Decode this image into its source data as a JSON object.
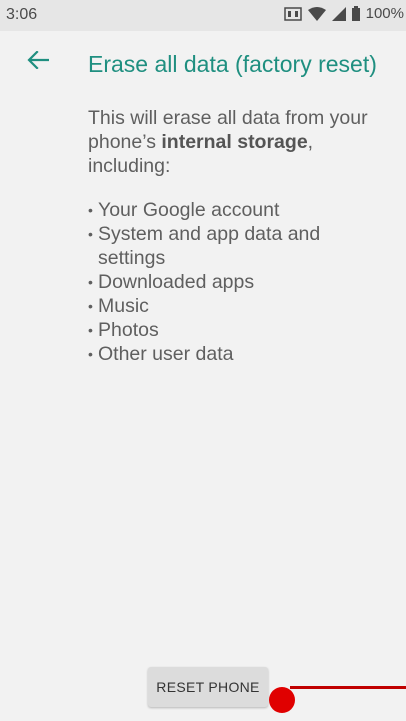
{
  "status_bar": {
    "time": "3:06",
    "battery_text": "100%",
    "icons": [
      "nfc-icon",
      "wifi-icon",
      "signal-icon",
      "battery-icon"
    ]
  },
  "app_bar": {
    "back_icon": "arrow-back-icon",
    "title": "Erase all data (factory reset)"
  },
  "content": {
    "intro_before": "This will erase all data from your phone’s ",
    "intro_bold": "internal storage",
    "intro_after": ", including:",
    "items": [
      "Your Google account",
      "System and app data and settings",
      "Downloaded apps",
      "Music",
      "Photos",
      "Other user data"
    ]
  },
  "actions": {
    "reset_label": "RESET PHONE"
  },
  "colors": {
    "accent": "#1f8f80",
    "background": "#f2f2f2",
    "status_bar": "#e6e6e6",
    "touch_indicator": "#e00000"
  }
}
